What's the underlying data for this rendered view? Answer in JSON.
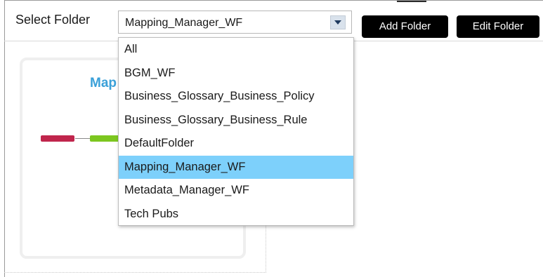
{
  "toolbar": {
    "select_label": "Select Folder",
    "selected_folder": "Mapping_Manager_WF",
    "add_folder_label": "Add Folder",
    "edit_folder_label": "Edit Folder"
  },
  "dropdown": {
    "options": [
      {
        "label": "All",
        "selected": false
      },
      {
        "label": "BGM_WF",
        "selected": false
      },
      {
        "label": "Business_Glossary_Business_Policy",
        "selected": false
      },
      {
        "label": "Business_Glossary_Business_Rule",
        "selected": false
      },
      {
        "label": "DefaultFolder",
        "selected": false
      },
      {
        "label": "Mapping_Manager_WF",
        "selected": true
      },
      {
        "label": "Metadata_Manager_WF",
        "selected": false
      },
      {
        "label": "Tech Pubs",
        "selected": false
      }
    ]
  },
  "card": {
    "title": "Map"
  },
  "colors": {
    "selected_option_bg": "#7dd0fb",
    "button_bg": "#000000",
    "card_title": "#3aa0d8",
    "flow_node_red": "#c0254c",
    "flow_node_green": "#7cc61f"
  }
}
